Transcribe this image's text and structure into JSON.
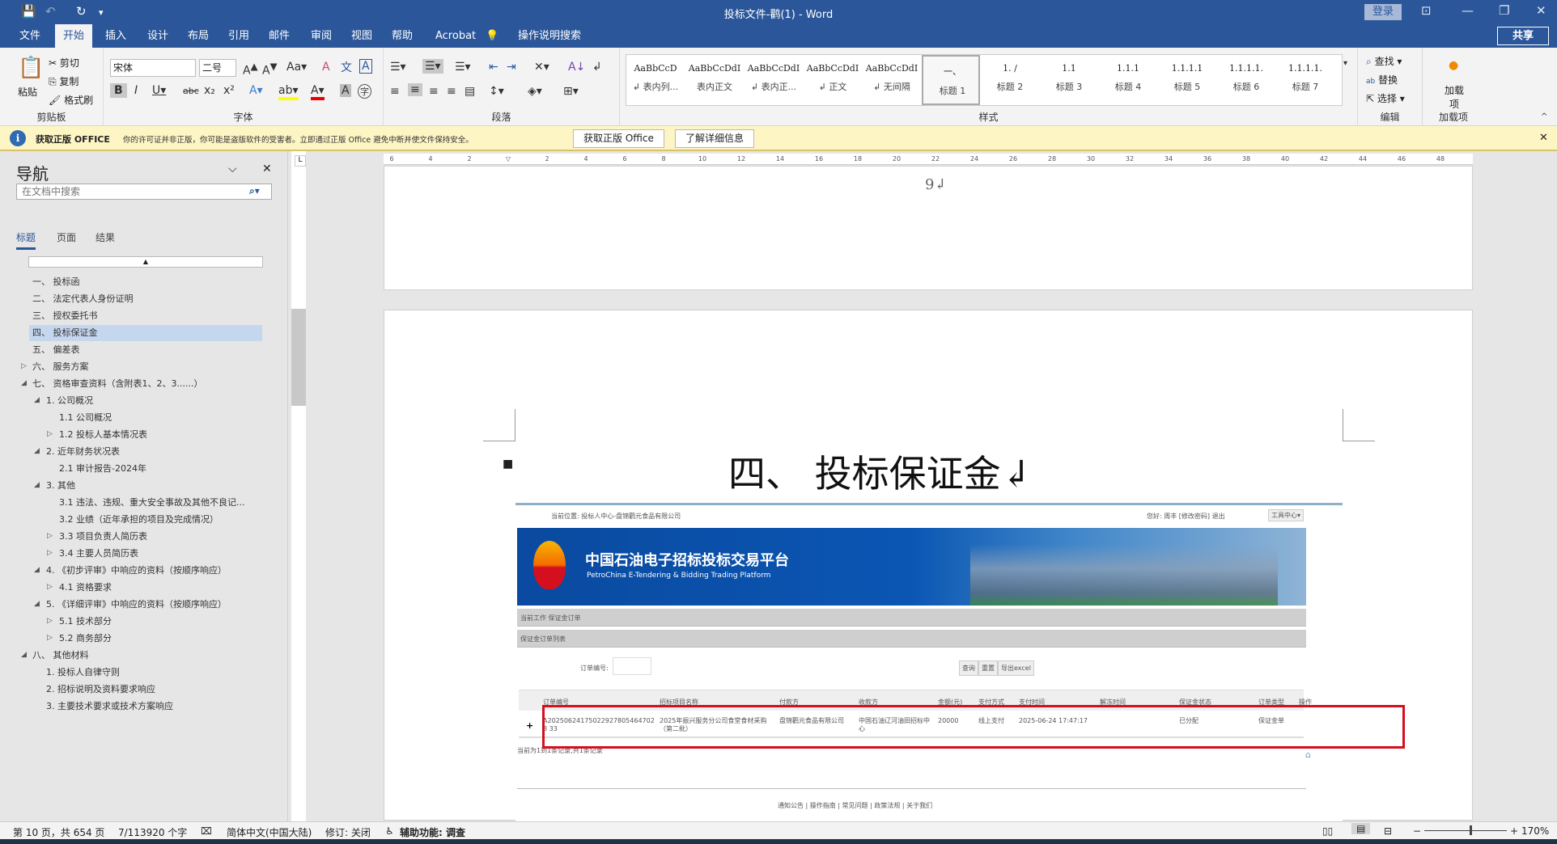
{
  "titlebar": {
    "title": "投标文件-鹳(1)  -  Word",
    "login": "登录",
    "share": "共享"
  },
  "tabs": [
    "文件",
    "开始",
    "插入",
    "设计",
    "布局",
    "引用",
    "邮件",
    "审阅",
    "视图",
    "帮助",
    "Acrobat",
    "操作说明搜索"
  ],
  "ribbon": {
    "clipboard": {
      "paste": "粘贴",
      "cut": "剪切",
      "copy": "复制",
      "format_painter": "格式刷",
      "label": "剪贴板"
    },
    "font": {
      "name": "宋体",
      "size": "二号",
      "label": "字体"
    },
    "paragraph": {
      "label": "段落"
    },
    "styles": {
      "items": [
        {
          "preview": "AaBbCcD",
          "name": "↲ 表内列..."
        },
        {
          "preview": "AaBbCcDdI",
          "name": "表内正文"
        },
        {
          "preview": "AaBbCcDdI",
          "name": "↲ 表内正..."
        },
        {
          "preview": "AaBbCcDdI",
          "name": "↲ 正文"
        },
        {
          "preview": "AaBbCcDdI",
          "name": "↲ 无间隔"
        },
        {
          "preview": "一、",
          "name": "标题 1"
        },
        {
          "preview": "1.  /",
          "name": "标题 2"
        },
        {
          "preview": "1.1",
          "name": "标题 3"
        },
        {
          "preview": "1.1.1",
          "name": "标题 4"
        },
        {
          "preview": "1.1.1.1",
          "name": "标题 5"
        },
        {
          "preview": "1.1.1.1.",
          "name": "标题 6"
        },
        {
          "preview": "1.1.1.1.",
          "name": "标题 7"
        }
      ],
      "label": "样式"
    },
    "editing": {
      "find": "查找",
      "replace": "替换",
      "select": "选择",
      "label": "编辑"
    },
    "addins": {
      "button": "加载项",
      "label": "加载项"
    }
  },
  "infobar": {
    "title": "获取正版 OFFICE",
    "message": "你的许可证并非正版，你可能是盗版软件的受害者。立即通过正版 Office 避免中断并使文件保持安全。",
    "btn_get": "获取正版 Office",
    "btn_learn": "了解详细信息"
  },
  "nav": {
    "title": "导航",
    "search_placeholder": "在文档中搜索",
    "tabs": [
      "标题",
      "页面",
      "结果"
    ],
    "items": [
      {
        "label": "一、  投标函",
        "level": 0,
        "toggle": ""
      },
      {
        "label": "二、  法定代表人身份证明",
        "level": 0,
        "toggle": ""
      },
      {
        "label": "三、  授权委托书",
        "level": 0,
        "toggle": ""
      },
      {
        "label": "四、  投标保证金",
        "level": 0,
        "toggle": "",
        "selected": true
      },
      {
        "label": "五、  偏差表",
        "level": 0,
        "toggle": ""
      },
      {
        "label": "六、  服务方案",
        "level": 0,
        "toggle": "▷"
      },
      {
        "label": "七、  资格审查资料（含附表1、2、3......）",
        "level": 0,
        "toggle": "◢"
      },
      {
        "label": "1. 公司概况",
        "level": 1,
        "toggle": "◢"
      },
      {
        "label": "1.1 公司概况",
        "level": 2,
        "toggle": ""
      },
      {
        "label": "1.2 投标人基本情况表",
        "level": 2,
        "toggle": "▷"
      },
      {
        "label": "2. 近年财务状况表",
        "level": 1,
        "toggle": "◢"
      },
      {
        "label": "2.1 审计报告-2024年",
        "level": 2,
        "toggle": ""
      },
      {
        "label": "3. 其他",
        "level": 1,
        "toggle": "◢"
      },
      {
        "label": "3.1 违法、违规、重大安全事故及其他不良记...",
        "level": 2,
        "toggle": ""
      },
      {
        "label": "3.2 业绩（近年承担的项目及完成情况）",
        "level": 2,
        "toggle": ""
      },
      {
        "label": "3.3 项目负责人简历表",
        "level": 2,
        "toggle": "▷"
      },
      {
        "label": "3.4 主要人员简历表",
        "level": 2,
        "toggle": "▷"
      },
      {
        "label": "4. 《初步评审》中响应的资料（按顺序响应）",
        "level": 1,
        "toggle": "◢"
      },
      {
        "label": "4.1 资格要求",
        "level": 2,
        "toggle": "▷"
      },
      {
        "label": "5. 《详细评审》中响应的资料（按顺序响应）",
        "level": 1,
        "toggle": "◢"
      },
      {
        "label": "5.1 技术部分",
        "level": 2,
        "toggle": "▷"
      },
      {
        "label": "5.2 商务部分",
        "level": 2,
        "toggle": "▷"
      },
      {
        "label": "八、  其他材料",
        "level": 0,
        "toggle": "◢"
      },
      {
        "label": "1. 投标人自律守则",
        "level": 1,
        "toggle": ""
      },
      {
        "label": "2. 招标说明及资料要求响应",
        "level": 1,
        "toggle": ""
      },
      {
        "label": "3. 主要技术要求或技术方案响应",
        "level": 1,
        "toggle": ""
      }
    ]
  },
  "document": {
    "page_number": "9↲",
    "heading": "四、   投标保证金↲"
  },
  "embedded": {
    "location": "当前位置: 投标人中心-盘锦鹳元食品有限公司",
    "user_links": "您好: 周丰  [修改密码]  退出",
    "tool_center": "工具中心▾",
    "platform_cn": "中国石油电子招标投标交易平台",
    "platform_en": "PetroChina E-Tendering & Bidding Trading Platform",
    "current_work": "当前工作  保证金订单",
    "list_title": "保证金订单列表",
    "order_no_label": "订单编号:",
    "buttons": [
      "查询",
      "重置",
      "导出excel"
    ],
    "columns": [
      "订单编号",
      "招标项目名称",
      "付款方",
      "收款方",
      "金额(元)",
      "支付方式",
      "支付时间",
      "解冻时间",
      "保证金状态",
      "订单类型",
      "操作"
    ],
    "row": [
      "A202506241750229278054647028 33",
      "2025年振兴服务分公司食堂食材采购（第二批）",
      "盘锦鹳元食品有限公司",
      "中国石油辽河油田招标中心",
      "20000",
      "线上支付",
      "2025-06-24 17:47:17",
      "",
      "已分配",
      "保证金单",
      ""
    ],
    "pager": "当前为1到1条记录,共1条记录",
    "footer": "通知公告 | 操作指南 | 常见问题 | 政策法规 | 关于我们"
  },
  "statusbar": {
    "page": "第 10 页，共 654 页",
    "words": "7/113920 个字",
    "language": "简体中文(中国大陆)",
    "track": "修订: 关闭",
    "accessibility": "辅助功能: 调查",
    "zoom": "170%"
  }
}
